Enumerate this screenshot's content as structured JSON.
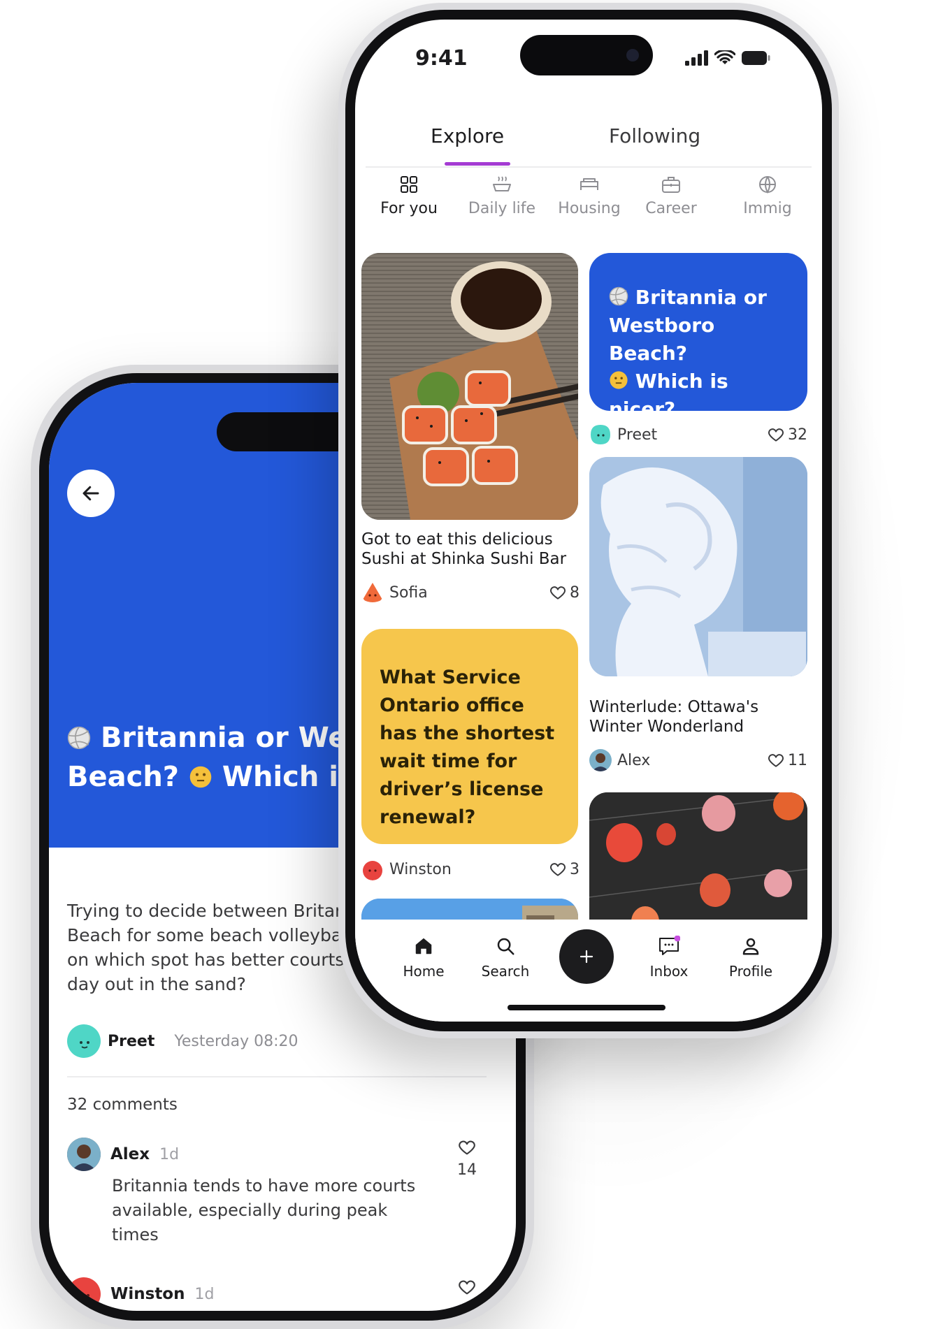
{
  "status_bar": {
    "time": "9:41"
  },
  "feed": {
    "tabs": [
      {
        "label": "Explore"
      },
      {
        "label": "Following"
      }
    ],
    "categories": [
      {
        "label": "For you",
        "icon": "grid-icon"
      },
      {
        "label": "Daily life",
        "icon": "pot-icon"
      },
      {
        "label": "Housing",
        "icon": "bed-icon"
      },
      {
        "label": "Career",
        "icon": "briefcase-icon"
      },
      {
        "label": "Immig",
        "icon": "globe-icon"
      }
    ],
    "cards": [
      {
        "caption_line1": "Got to eat this delicious",
        "caption_line2": "Sushi at Shinka Sushi Bar",
        "author": "Sofia",
        "likes": "8"
      },
      {
        "quote_line1": "Britannia or",
        "quote_line2": "Westboro Beach?",
        "quote_line3": "Which is nicer?",
        "author": "Preet",
        "likes": "32"
      },
      {
        "caption_line1": "Winterlude: Ottawa's",
        "caption_line2": "Winter Wonderland",
        "author": "Alex",
        "likes": "11"
      },
      {
        "quote": "What Service Ontario office has the shortest wait time for driver’s license renewal?",
        "author": "Winston",
        "likes": "3"
      }
    ],
    "colors": {
      "blue": "#2358d9",
      "yellow": "#f6c64c",
      "accent": "#a43bd3"
    }
  },
  "tabbar": {
    "items": [
      {
        "label": "Home",
        "icon": "home-icon"
      },
      {
        "label": "Search",
        "icon": "search-icon"
      },
      {
        "label": "",
        "icon": "plus-icon"
      },
      {
        "label": "Inbox",
        "icon": "inbox-icon"
      },
      {
        "label": "Profile",
        "icon": "profile-icon"
      }
    ]
  },
  "post": {
    "title_line1": "Britannia or Westb",
    "title_line2_a": "Beach?",
    "title_line2_b": "Which is n",
    "body_l1": "Trying to decide between Britannia",
    "body_l2": "Beach for some beach volleyball a",
    "body_l3": "on which spot has better courts ar",
    "body_l4": "day out in the sand?",
    "author": "Preet",
    "time": "Yesterday 08:20",
    "comments_count": "32 comments",
    "comments": [
      {
        "name": "Alex",
        "age": "1d",
        "text_l1": "Britannia tends to have more courts",
        "text_l2": "available, especially during peak",
        "text_l3": "times",
        "likes": "14"
      },
      {
        "name": "Winston",
        "age": "1d"
      }
    ]
  }
}
